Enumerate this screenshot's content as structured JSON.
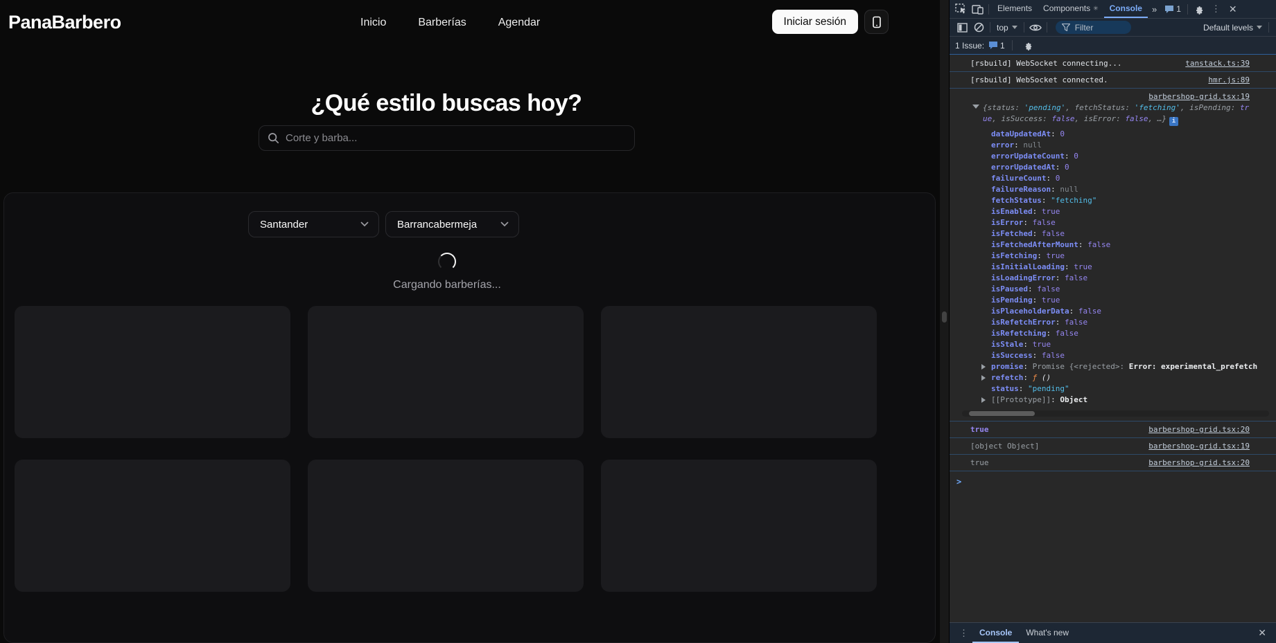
{
  "site": {
    "logo": "PanaBarbero",
    "nav": [
      {
        "label": "Inicio"
      },
      {
        "label": "Barberías"
      },
      {
        "label": "Agendar"
      }
    ],
    "login_button": "Iniciar sesión",
    "hero": {
      "title": "¿Qué estilo buscas hoy?",
      "search_placeholder": "Corte y barba..."
    },
    "filters": {
      "department": "Santander",
      "city": "Barrancabermeja"
    },
    "loading_text": "Cargando barberías...",
    "skeleton_card_count": 6
  },
  "devtools": {
    "tabs": {
      "elements": "Elements",
      "components": "Components",
      "console": "Console"
    },
    "tab_issue_count": "1",
    "toolbar": {
      "context": "top",
      "filter_placeholder": "Filter",
      "levels": "Default levels"
    },
    "issues_bar": {
      "label": "1 Issue:",
      "count": "1"
    },
    "console": {
      "messages": [
        {
          "text": "[rsbuild] WebSocket connecting...",
          "source": "tanstack.ts:39"
        },
        {
          "text": "[rsbuild] WebSocket connected.",
          "source": "hmr.js:89"
        }
      ],
      "object_log": {
        "source": "barbershop-grid.tsx:19",
        "preview_tokens": [
          {
            "t": "{"
          },
          {
            "t": "status"
          },
          {
            "t": ": "
          },
          {
            "t": "'pending'",
            "c": "str"
          },
          {
            "t": ", "
          },
          {
            "t": "fetchStatus"
          },
          {
            "t": ": "
          },
          {
            "t": "'fetching'",
            "c": "str"
          },
          {
            "t": ", "
          },
          {
            "t": "isPending"
          },
          {
            "t": ": "
          },
          {
            "t": "true",
            "c": "bool"
          },
          {
            "t": ", "
          },
          {
            "t": "isSuccess"
          },
          {
            "t": ": "
          },
          {
            "t": "false",
            "c": "bool"
          },
          {
            "t": ", "
          },
          {
            "t": "isError"
          },
          {
            "t": ": "
          },
          {
            "t": "false",
            "c": "bool"
          },
          {
            "t": ", "
          },
          {
            "t": "…}"
          }
        ],
        "properties": [
          {
            "key": "dataUpdatedAt",
            "kc": "key",
            "parts": [
              {
                "t": "0",
                "c": "num"
              }
            ]
          },
          {
            "key": "error",
            "kc": "key",
            "parts": [
              {
                "t": "null",
                "c": "null"
              }
            ]
          },
          {
            "key": "errorUpdateCount",
            "kc": "key",
            "parts": [
              {
                "t": "0",
                "c": "num"
              }
            ]
          },
          {
            "key": "errorUpdatedAt",
            "kc": "key",
            "parts": [
              {
                "t": "0",
                "c": "num"
              }
            ]
          },
          {
            "key": "failureCount",
            "kc": "key",
            "parts": [
              {
                "t": "0",
                "c": "num"
              }
            ]
          },
          {
            "key": "failureReason",
            "kc": "key",
            "parts": [
              {
                "t": "null",
                "c": "null"
              }
            ]
          },
          {
            "key": "fetchStatus",
            "kc": "key",
            "parts": [
              {
                "t": "\"fetching\"",
                "c": "str"
              }
            ]
          },
          {
            "key": "isEnabled",
            "kc": "key",
            "parts": [
              {
                "t": "true",
                "c": "bool"
              }
            ]
          },
          {
            "key": "isError",
            "kc": "key",
            "parts": [
              {
                "t": "false",
                "c": "bool"
              }
            ]
          },
          {
            "key": "isFetched",
            "kc": "key",
            "parts": [
              {
                "t": "false",
                "c": "bool"
              }
            ]
          },
          {
            "key": "isFetchedAfterMount",
            "kc": "key",
            "parts": [
              {
                "t": "false",
                "c": "bool"
              }
            ]
          },
          {
            "key": "isFetching",
            "kc": "key",
            "parts": [
              {
                "t": "true",
                "c": "bool"
              }
            ]
          },
          {
            "key": "isInitialLoading",
            "kc": "key",
            "parts": [
              {
                "t": "true",
                "c": "bool"
              }
            ]
          },
          {
            "key": "isLoadingError",
            "kc": "key",
            "parts": [
              {
                "t": "false",
                "c": "bool"
              }
            ]
          },
          {
            "key": "isPaused",
            "kc": "key",
            "parts": [
              {
                "t": "false",
                "c": "bool"
              }
            ]
          },
          {
            "key": "isPending",
            "kc": "key",
            "parts": [
              {
                "t": "true",
                "c": "bool"
              }
            ]
          },
          {
            "key": "isPlaceholderData",
            "kc": "key",
            "parts": [
              {
                "t": "false",
                "c": "bool"
              }
            ]
          },
          {
            "key": "isRefetchError",
            "kc": "key",
            "parts": [
              {
                "t": "false",
                "c": "bool"
              }
            ]
          },
          {
            "key": "isRefetching",
            "kc": "key",
            "parts": [
              {
                "t": "false",
                "c": "bool"
              }
            ]
          },
          {
            "key": "isStale",
            "kc": "key",
            "parts": [
              {
                "t": "true",
                "c": "bool"
              }
            ]
          },
          {
            "key": "isSuccess",
            "kc": "key",
            "parts": [
              {
                "t": "false",
                "c": "bool"
              }
            ]
          },
          {
            "key": "promise",
            "kc": "key",
            "arrow": true,
            "parts": [
              {
                "t": "Promise {",
                "c": "muted"
              },
              {
                "t": "<rejected>",
                "c": "muted"
              },
              {
                "t": ": ",
                "c": "muted"
              },
              {
                "t": "Error: experimental_prefetch",
                "c": "bold"
              }
            ]
          },
          {
            "key": "refetch",
            "kc": "key",
            "arrow": true,
            "parts": [
              {
                "t": "ƒ",
                "c": "fn"
              },
              {
                "t": " ()",
                "c": "fn2"
              }
            ]
          },
          {
            "key": "status",
            "kc": "key",
            "parts": [
              {
                "t": "\"pending\"",
                "c": "str"
              }
            ]
          },
          {
            "key": "[[Prototype]]",
            "kc": "keymuted",
            "arrow": true,
            "parts": [
              {
                "t": "Object",
                "c": "bold"
              }
            ]
          }
        ]
      },
      "tail_messages": [
        {
          "text": "true",
          "style": "tail-bool",
          "source": "barbershop-grid.tsx:20"
        },
        {
          "text": "[object Object]",
          "style": "tail-muted",
          "source": "barbershop-grid.tsx:19"
        },
        {
          "text": "true",
          "style": "tail-muted",
          "source": "barbershop-grid.tsx:20"
        }
      ],
      "prompt": ">"
    },
    "drawer": {
      "tabs": [
        {
          "label": "Console",
          "active": true
        },
        {
          "label": "What's new"
        }
      ]
    }
  }
}
